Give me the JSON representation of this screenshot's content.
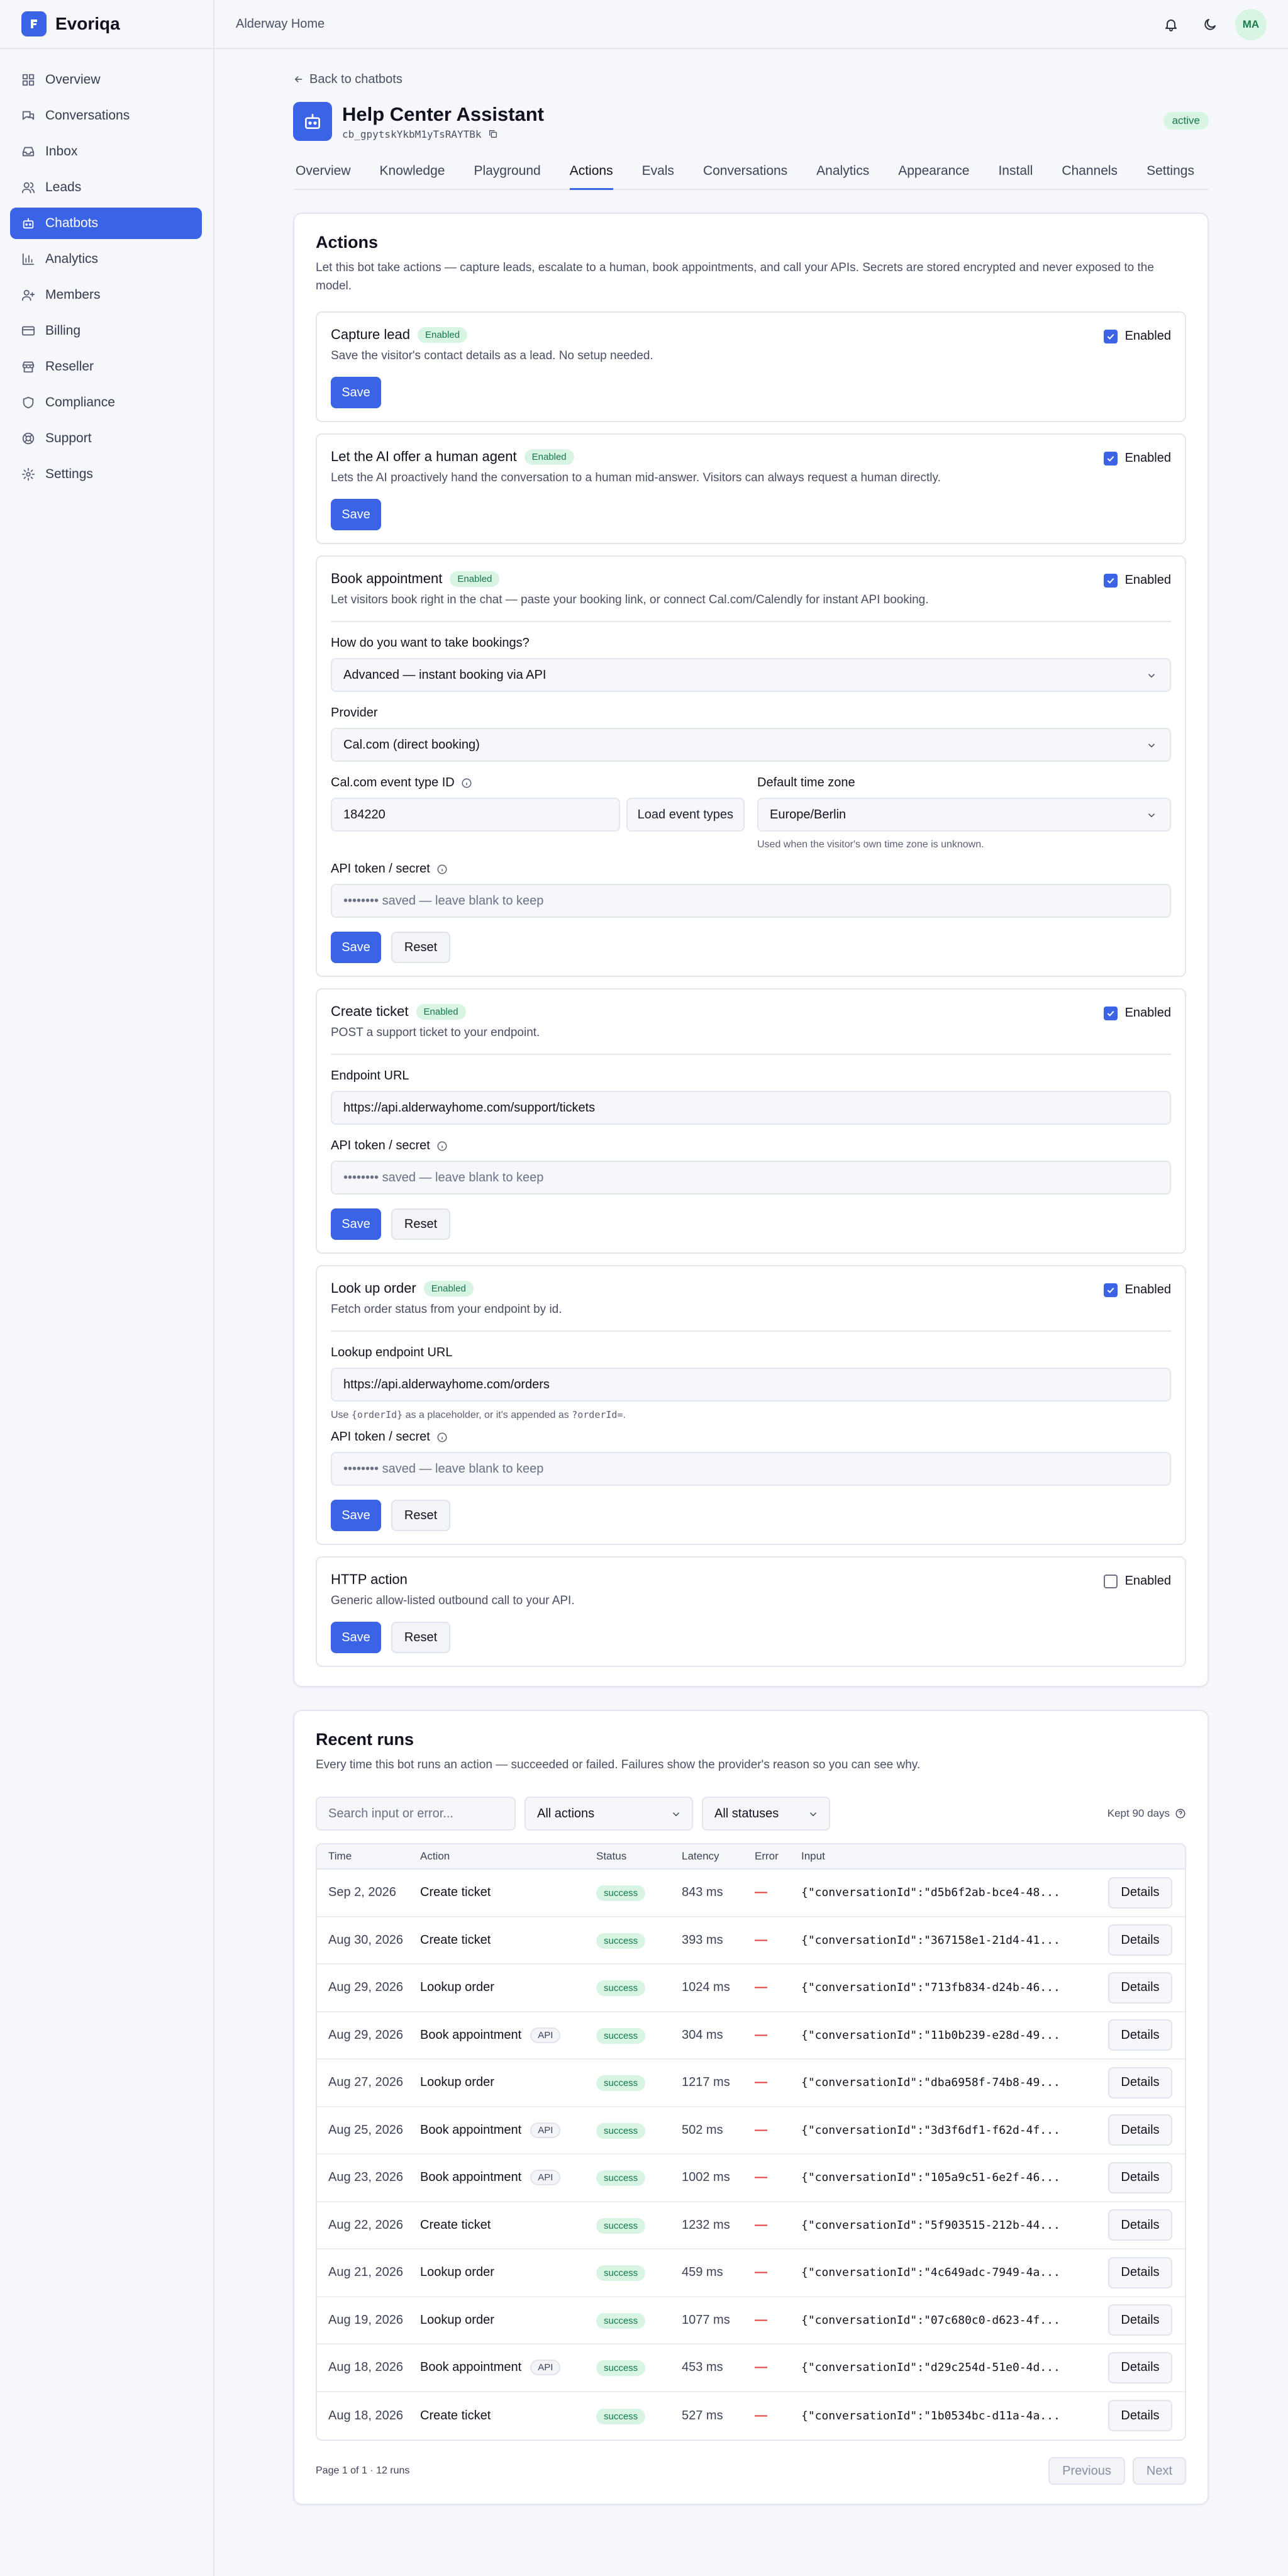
{
  "brand": {
    "name": "Evoriqa"
  },
  "sidebar": {
    "items": [
      {
        "label": "Overview"
      },
      {
        "label": "Conversations"
      },
      {
        "label": "Inbox"
      },
      {
        "label": "Leads"
      },
      {
        "label": "Chatbots"
      },
      {
        "label": "Analytics"
      },
      {
        "label": "Members"
      },
      {
        "label": "Billing"
      },
      {
        "label": "Reseller"
      },
      {
        "label": "Compliance"
      },
      {
        "label": "Support"
      },
      {
        "label": "Settings"
      }
    ]
  },
  "topbar": {
    "workspace": "Alderway Home",
    "avatar_initials": "MA"
  },
  "header": {
    "back_label": "Back to chatbots",
    "title": "Help Center Assistant",
    "bot_id": "cb_gpytskYkbM1yTsRAYTBk",
    "status": "active"
  },
  "tabs": [
    "Overview",
    "Knowledge",
    "Playground",
    "Actions",
    "Evals",
    "Conversations",
    "Analytics",
    "Appearance",
    "Install",
    "Channels",
    "Settings"
  ],
  "actions_card": {
    "title": "Actions",
    "subtitle": "Let this bot take actions — capture leads, escalate to a human, book appointments, and call your APIs. Secrets are stored encrypted and never exposed to the model.",
    "enabled_label": "Enabled",
    "save_label": "Save",
    "reset_label": "Reset",
    "capture": {
      "name": "Capture lead",
      "badge": "Enabled",
      "desc": "Save the visitor's contact details as a lead. No setup needed."
    },
    "human": {
      "name": "Let the AI offer a human agent",
      "badge": "Enabled",
      "desc": "Lets the AI proactively hand the conversation to a human mid-answer. Visitors can always request a human directly."
    },
    "booking": {
      "name": "Book appointment",
      "badge": "Enabled",
      "desc": "Let visitors book right in the chat — paste your booking link, or connect Cal.com/Calendly for instant API booking.",
      "mode_label": "How do you want to take bookings?",
      "mode_value": "Advanced — instant booking via API",
      "provider_label": "Provider",
      "provider_value": "Cal.com (direct booking)",
      "event_label": "Cal.com event type ID",
      "event_value": "184220",
      "load_label": "Load event types",
      "tz_label": "Default time zone",
      "tz_value": "Europe/Berlin",
      "tz_hint": "Used when the visitor's own time zone is unknown.",
      "token_label": "API token / secret",
      "token_placeholder": "•••••••• saved — leave blank to keep"
    },
    "ticket": {
      "name": "Create ticket",
      "badge": "Enabled",
      "desc": "POST a support ticket to your endpoint.",
      "url_label": "Endpoint URL",
      "url_value": "https://api.alderwayhome.com/support/tickets",
      "token_label": "API token / secret",
      "token_placeholder": "•••••••• saved — leave blank to keep"
    },
    "order": {
      "name": "Look up order",
      "badge": "Enabled",
      "desc": "Fetch order status from your endpoint by id.",
      "url_label": "Lookup endpoint URL",
      "url_value": "https://api.alderwayhome.com/orders",
      "hint_pre": "Use ",
      "hint_code1": "{orderId}",
      "hint_mid": " as a placeholder, or it's appended as ",
      "hint_code2": "?orderId=",
      "hint_post": ".",
      "token_label": "API token / secret",
      "token_placeholder": "•••••••• saved — leave blank to keep"
    },
    "http": {
      "name": "HTTP action",
      "desc": "Generic allow-listed outbound call to your API."
    }
  },
  "runs": {
    "title": "Recent runs",
    "subtitle": "Every time this bot runs an action — succeeded or failed. Failures show the provider's reason so you can see why.",
    "search_placeholder": "Search input or error...",
    "action_filter": "All actions",
    "status_filter": "All statuses",
    "kept": "Kept 90 days",
    "columns": {
      "time": "Time",
      "action": "Action",
      "status": "Status",
      "latency": "Latency",
      "error": "Error",
      "input": "Input"
    },
    "api_label": "API",
    "details_label": "Details",
    "rows": [
      {
        "time": "Sep 2, 2026",
        "action": "Create ticket",
        "api": false,
        "status": "success",
        "latency": "843 ms",
        "error": "—",
        "input": "{\"conversationId\":\"d5b6f2ab-bce4-48..."
      },
      {
        "time": "Aug 30, 2026",
        "action": "Create ticket",
        "api": false,
        "status": "success",
        "latency": "393 ms",
        "error": "—",
        "input": "{\"conversationId\":\"367158e1-21d4-41..."
      },
      {
        "time": "Aug 29, 2026",
        "action": "Lookup order",
        "api": false,
        "status": "success",
        "latency": "1024 ms",
        "error": "—",
        "input": "{\"conversationId\":\"713fb834-d24b-46..."
      },
      {
        "time": "Aug 29, 2026",
        "action": "Book appointment",
        "api": true,
        "status": "success",
        "latency": "304 ms",
        "error": "—",
        "input": "{\"conversationId\":\"11b0b239-e28d-49..."
      },
      {
        "time": "Aug 27, 2026",
        "action": "Lookup order",
        "api": false,
        "status": "success",
        "latency": "1217 ms",
        "error": "—",
        "input": "{\"conversationId\":\"dba6958f-74b8-49..."
      },
      {
        "time": "Aug 25, 2026",
        "action": "Book appointment",
        "api": true,
        "status": "success",
        "latency": "502 ms",
        "error": "—",
        "input": "{\"conversationId\":\"3d3f6df1-f62d-4f..."
      },
      {
        "time": "Aug 23, 2026",
        "action": "Book appointment",
        "api": true,
        "status": "success",
        "latency": "1002 ms",
        "error": "—",
        "input": "{\"conversationId\":\"105a9c51-6e2f-46..."
      },
      {
        "time": "Aug 22, 2026",
        "action": "Create ticket",
        "api": false,
        "status": "success",
        "latency": "1232 ms",
        "error": "—",
        "input": "{\"conversationId\":\"5f903515-212b-44..."
      },
      {
        "time": "Aug 21, 2026",
        "action": "Lookup order",
        "api": false,
        "status": "success",
        "latency": "459 ms",
        "error": "—",
        "input": "{\"conversationId\":\"4c649adc-7949-4a..."
      },
      {
        "time": "Aug 19, 2026",
        "action": "Lookup order",
        "api": false,
        "status": "success",
        "latency": "1077 ms",
        "error": "—",
        "input": "{\"conversationId\":\"07c680c0-d623-4f..."
      },
      {
        "time": "Aug 18, 2026",
        "action": "Book appointment",
        "api": true,
        "status": "success",
        "latency": "453 ms",
        "error": "—",
        "input": "{\"conversationId\":\"d29c254d-51e0-4d..."
      },
      {
        "time": "Aug 18, 2026",
        "action": "Create ticket",
        "api": false,
        "status": "success",
        "latency": "527 ms",
        "error": "—",
        "input": "{\"conversationId\":\"1b0534bc-d11a-4a..."
      }
    ],
    "pager_text": "Page 1 of 1 · 12 runs",
    "prev_label": "Previous",
    "next_label": "Next"
  },
  "colors": {
    "accent": "#3b63e6",
    "success_bg": "#d8f5e4",
    "success_fg": "#16784a",
    "error_dash": "#e23d3d"
  }
}
